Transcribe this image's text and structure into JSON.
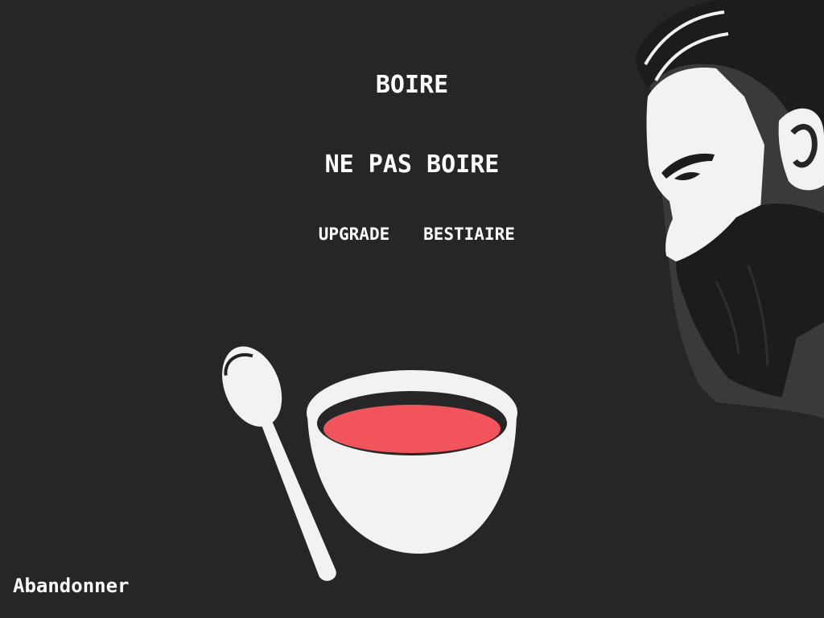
{
  "menu": {
    "drink_label": "BOIRE",
    "dont_drink_label": "NE PAS BOIRE",
    "upgrade_label": "UPGRADE",
    "bestiary_label": "BESTIAIRE"
  },
  "footer": {
    "quit_label": "Abandonner"
  },
  "scene": {
    "background_color": "#262626",
    "soup_color": "#f2545b",
    "bowl_color": "#ffffff",
    "character_icon": "bearded-man-profile",
    "spoon_icon": "spoon",
    "bowl_icon": "soup-bowl"
  }
}
